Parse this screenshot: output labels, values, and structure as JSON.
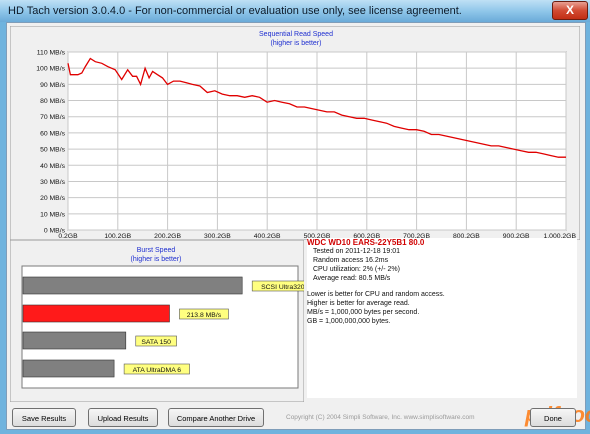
{
  "window": {
    "title": "HD Tach version 3.0.4.0  - For non-commercial or evaluation use only, see license agreement.",
    "close_glyph": "X"
  },
  "seq_chart": {
    "title": "Sequential Read Speed",
    "subtitle": "(higher is better)"
  },
  "burst_chart": {
    "title": "Burst Speed",
    "subtitle": "(higher is better)",
    "bars": [
      {
        "label": "SCSI Ultra320",
        "value": 320,
        "highlight": false
      },
      {
        "label": "213.8 MB/s",
        "value": 213.8,
        "highlight": true
      },
      {
        "label": "SATA 150",
        "value": 150,
        "highlight": false
      },
      {
        "label": "ATA UltraDMA 6",
        "value": 133,
        "highlight": false
      }
    ]
  },
  "info": {
    "drive_title": "WDC WD10 EARS-22Y5B1 80.0",
    "tested_on": "Tested on 2011-12-18 19:01",
    "random_access": "Random access 16.2ms",
    "cpu_utilization": "CPU utilization: 2% (+/- 2%)",
    "average_read": "Average read: 80.5 MB/s",
    "note1": "Lower is better for CPU and random access.",
    "note2": "Higher is better for average read.",
    "note3": "MB/s = 1,000,000 bytes per second.",
    "note4": "GB = 1,000,000,000 bytes."
  },
  "footer": {
    "save_label": "Save Results",
    "upload_label": "Upload Results",
    "compare_label": "Compare Another Drive",
    "copyright": "Copyright (C) 2004 Simpli Software, Inc. www.simplisoftware.com",
    "done_label": "Done",
    "logo_text": "pdfcool"
  },
  "chart_data": [
    {
      "type": "line",
      "title": "Sequential Read Speed",
      "subtitle": "(higher is better)",
      "x_ticks": [
        "0.2GB",
        "100.2GB",
        "200.2GB",
        "300.2GB",
        "400.2GB",
        "500.2GB",
        "600.2GB",
        "700.2GB",
        "800.2GB",
        "900.2GB",
        "1,000.2GB"
      ],
      "y_ticks": [
        "0 MB/s",
        "10 MB/s",
        "20 MB/s",
        "30 MB/s",
        "40 MB/s",
        "50 MB/s",
        "60 MB/s",
        "70 MB/s",
        "80 MB/s",
        "90 MB/s",
        "100 MB/s",
        "110 MB/s"
      ],
      "ylim": [
        0,
        110
      ],
      "xlim": [
        0.2,
        1000.2
      ],
      "x": [
        0.2,
        5,
        12,
        20,
        28,
        35,
        45,
        55,
        68,
        80,
        95,
        108,
        120,
        130,
        138,
        146,
        155,
        163,
        170,
        180,
        190,
        200,
        212,
        225,
        238,
        250,
        265,
        280,
        295,
        310,
        325,
        340,
        355,
        370,
        385,
        400,
        415,
        430,
        445,
        460,
        475,
        490,
        505,
        520,
        535,
        550,
        565,
        580,
        595,
        610,
        625,
        640,
        655,
        670,
        685,
        700,
        715,
        730,
        745,
        760,
        775,
        790,
        805,
        820,
        835,
        850,
        865,
        880,
        895,
        910,
        925,
        940,
        955,
        970,
        985,
        1000.2
      ],
      "values": [
        103,
        96,
        96,
        96,
        97,
        101,
        106,
        104,
        103,
        101,
        99,
        93,
        99,
        95,
        95,
        90,
        100,
        94,
        98,
        96,
        94,
        90,
        92,
        92,
        91,
        90,
        89,
        85,
        86,
        84,
        83,
        83,
        82,
        83,
        82,
        79,
        80,
        79,
        78,
        76,
        76,
        75,
        74,
        73,
        73,
        71,
        70,
        69,
        69,
        68,
        67,
        66,
        64,
        63,
        62,
        62,
        61,
        59,
        59,
        58,
        57,
        56,
        55,
        54,
        53,
        52,
        52,
        51,
        50,
        49,
        48,
        48,
        47,
        46,
        45,
        45
      ]
    },
    {
      "type": "bar",
      "title": "Burst Speed",
      "subtitle": "(higher is better)",
      "categories": [
        "SCSI Ultra320",
        "213.8 MB/s",
        "SATA 150",
        "ATA UltraDMA 6"
      ],
      "values": [
        320,
        213.8,
        150,
        133
      ]
    }
  ],
  "colors": {
    "line": "#e00000",
    "bar_gray": "#808080",
    "bar_red": "#ff1a1a",
    "label_bg": "#ffff80",
    "title_blue": "#1f2fd0",
    "titlebar": "#8cc4e8"
  }
}
